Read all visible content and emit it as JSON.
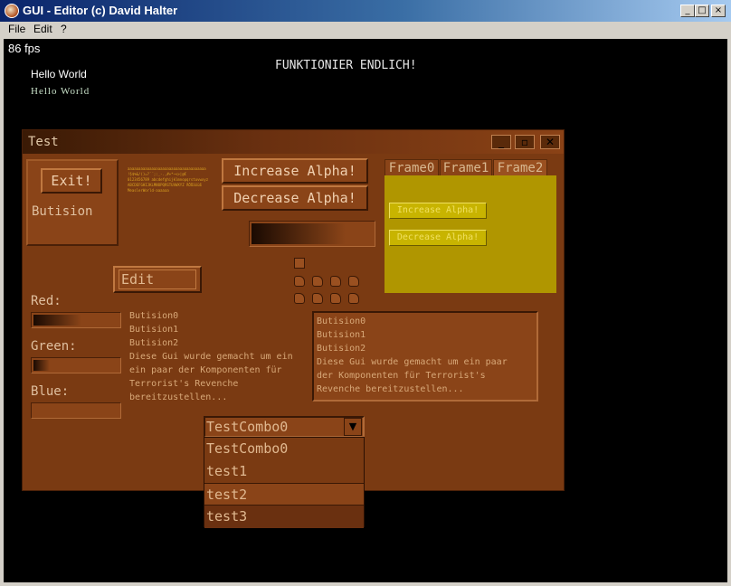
{
  "window": {
    "title": "GUI - Editor (c) David Halter",
    "min_glyph": "_",
    "max_glyph": "□",
    "close_glyph": "×"
  },
  "menu": {
    "items": [
      "File",
      "Edit",
      "?"
    ]
  },
  "overlay": {
    "fps": "86 fps",
    "headline": "FUNKTIONIER ENDLICH!",
    "hello_1": "Hello World",
    "hello_2": "Hello World"
  },
  "gui": {
    "title": "Test",
    "title_buttons": [
      "_",
      "▫",
      "✕"
    ],
    "exit_label": "Exit!",
    "butision_label": "Butision",
    "tiny_text": [
      "aaaaaaaaaaaaaaaaaaaaaaaaaaaaaaaaaaaa",
      "!§$%&/()=?`´;:_-.,#+*~<>|@€",
      "0123456789 abcdefghijklmnopqrstuvwxyz",
      "ABCDEFGHIJKLMNOPQRSTUVWXYZ ÄÖÜäöüß",
      "MeaslerWorld-aaaaaa"
    ],
    "increase_alpha": "Increase Alpha!",
    "decrease_alpha": "Decrease Alpha!",
    "alpha_level": 0.78,
    "edit_value": "Edit",
    "red_label": "Red:",
    "green_label": "Green:",
    "blue_label": "Blue:",
    "red_level": 0.58,
    "green_level": 0.22,
    "blue_level": 0.02,
    "static_text": [
      "Butision0",
      "Butision1",
      "Butision2",
      "Diese Gui wurde gemacht um ein",
      "ein paar der Komponenten für",
      "Terrorist's Revenche",
      "bereitzustellen..."
    ],
    "list_text": [
      "Butision0",
      "Butision1",
      "Butision2",
      "Diese Gui wurde gemacht um ein paar",
      "der Komponenten für Terrorist's",
      "Revenche bereitzustellen..."
    ],
    "tabs": [
      "Frame0",
      "Frame1",
      "Frame2"
    ],
    "frame_increase": "Increase Alpha!",
    "frame_decrease": "Decrease Alpha!",
    "combo_value": "TestCombo0",
    "combo_arrow": "▼",
    "combo_options": [
      "TestCombo0",
      "test1",
      "test2",
      "test3"
    ],
    "combo_selected_index": 2,
    "colors": {
      "window": "#7a3a12",
      "frame": "#b09600",
      "frame_button": "#c8b400"
    }
  }
}
